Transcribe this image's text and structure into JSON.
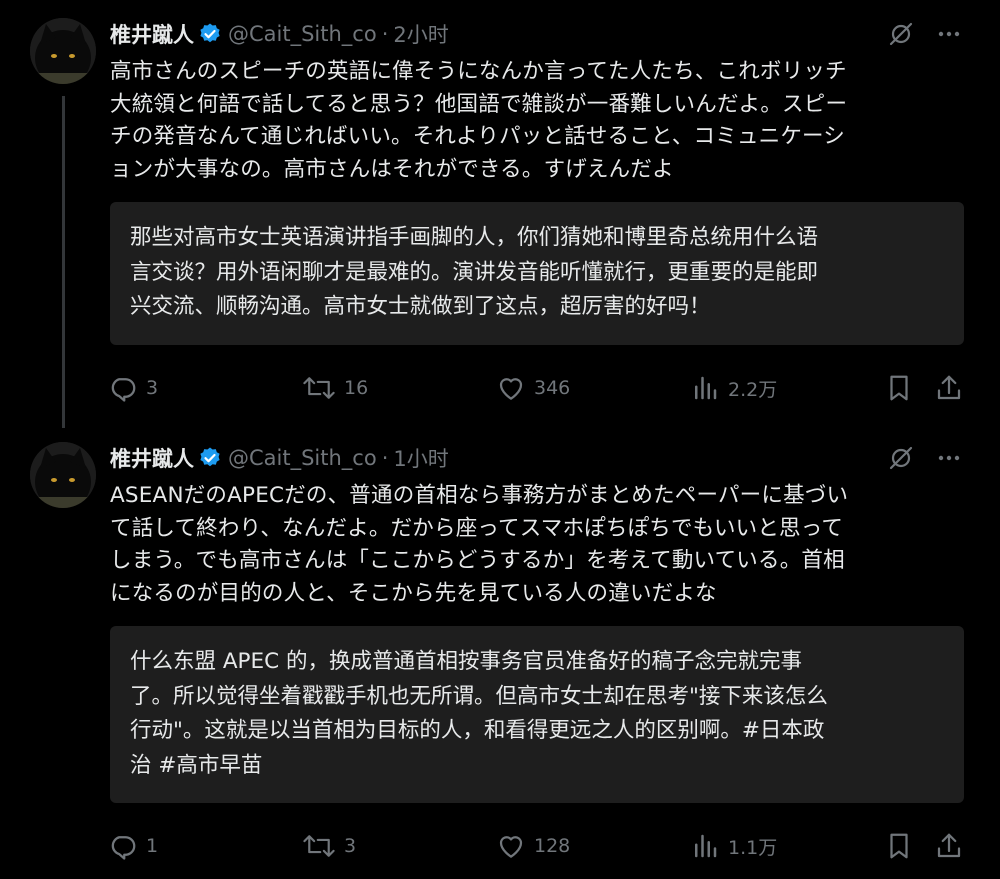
{
  "tweets": [
    {
      "author": {
        "name": "椎井蹴人",
        "handle": "@Cait_Sith_co"
      },
      "separator": "·",
      "time": "2小时",
      "text": "高市さんのスピーチの英語に偉そうになんか言ってた人たち、これボリッチ\n大統領と何語で話してると思う？他国語で雑談が一番難しいんだよ。スピー\nチの発音なんて通じればいい。それよりパッと話せること、コミュニケーシ\nョンが大事なの。高市さんはそれができる。すげえんだよ",
      "translation": "那些对高市女士英语演讲指手画脚的人，你们猜她和博里奇总统用什么语\n言交谈？用外语闲聊才是最难的。演讲发音能听懂就行，更重要的是能即\n兴交流、顺畅沟通。高市女士就做到了这点，超厉害的好吗！",
      "stats": {
        "replies": "3",
        "reposts": "16",
        "likes": "346",
        "views": "2.2万"
      }
    },
    {
      "author": {
        "name": "椎井蹴人",
        "handle": "@Cait_Sith_co"
      },
      "separator": "·",
      "time": "1小时",
      "text": "ASEANだのAPECだの、普通の首相なら事務方がまとめたペーパーに基づい\nて話して終わり、なんだよ。だから座ってスマホぽちぽちでもいいと思って\nしまう。でも高市さんは「ここからどうするか」を考えて動いている。首相\nになるのが目的の人と、そこから先を見ている人の違いだよな",
      "translation": "什么东盟 APEC 的，换成普通首相按事务官员准备好的稿子念完就完事\n了。所以觉得坐着戳戳手机也无所谓。但高市女士却在思考\"接下来该怎么\n行动\"。这就是以当首相为目标的人，和看得更远之人的区别啊。#日本政\n治 #高市早苗",
      "stats": {
        "replies": "1",
        "reposts": "3",
        "likes": "128",
        "views": "1.1万"
      }
    }
  ],
  "colors": {
    "background": "#000000",
    "text": "#e7e9ea",
    "muted": "#71767b",
    "verified": "#1d9bf0",
    "card": "#1e1e1e"
  },
  "icons": [
    "verified-badge-icon",
    "grok-icon",
    "more-icon",
    "reply-icon",
    "repost-icon",
    "like-icon",
    "views-icon",
    "bookmark-icon",
    "share-icon"
  ]
}
